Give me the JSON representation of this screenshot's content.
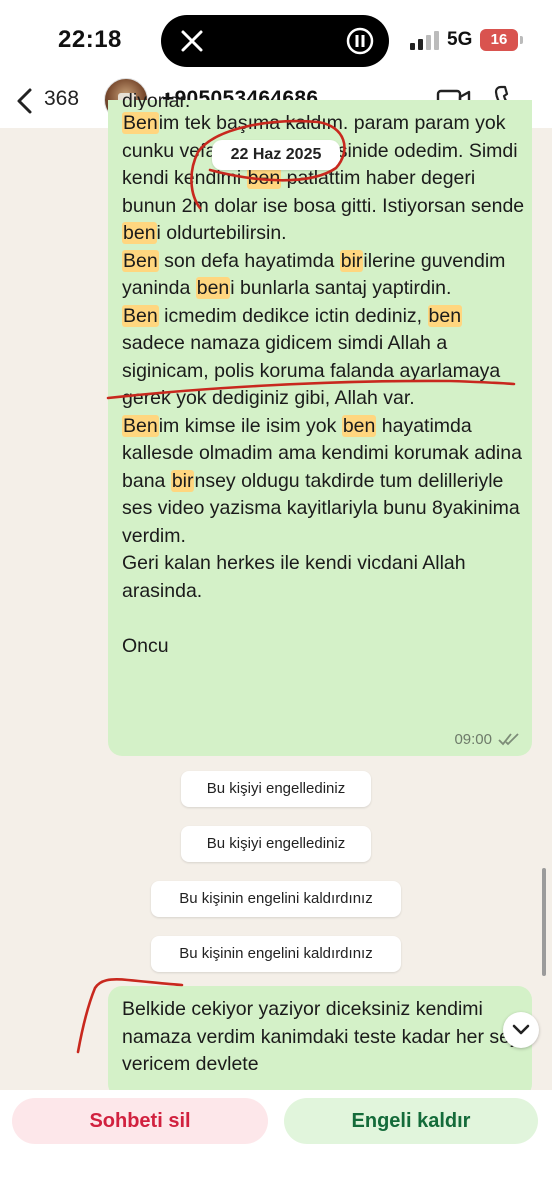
{
  "status": {
    "time": "22:18",
    "network": "5G",
    "battery": "16",
    "island_icon": "x-logo-icon"
  },
  "header": {
    "back_count": "368",
    "contact": "+905053464686"
  },
  "date_separator": "22 Haz 2025",
  "message1": {
    "partial_top": "diyorlar.",
    "time": "09:00",
    "paragraphs": [
      [
        {
          "t": "Ben",
          "h": true
        },
        {
          "t": "im tek başıma kaldım. "
        },
        {
          "t": "param param yok cunku vefat sonrasi vergisinide odedim. Simdi kendi kendimi "
        },
        {
          "t": "ben",
          "h": true
        },
        {
          "t": " patlattim haber degeri bunun 2m dolar ise bosa gitti. Istiyorsan sende "
        },
        {
          "t": "ben",
          "h": true
        },
        {
          "t": "i oldurtebilirsin."
        }
      ],
      [
        {
          "t": "Ben",
          "h": true
        },
        {
          "t": " son defa hayatimda "
        },
        {
          "t": "bir",
          "h": true
        },
        {
          "t": "ilerine guvendim yaninda "
        },
        {
          "t": "ben",
          "h": true
        },
        {
          "t": "i bunlarla santaj yaptirdin."
        }
      ],
      [
        {
          "t": "Ben",
          "h": true
        },
        {
          "t": " icmedim dedikce ictin dediniz, "
        },
        {
          "t": "ben",
          "h": true
        },
        {
          "t": " sadece namaza gidicem simdi Allah a siginicam, polis koruma falanda ayarlamaya gerek yok dediginiz gibi, Allah var."
        }
      ],
      [
        {
          "t": "Ben",
          "h": true
        },
        {
          "t": "im kimse ile isim yok "
        },
        {
          "t": "ben",
          "h": true
        },
        {
          "t": " hayatimda kallesde olmadim ama kendimi korumak adina bana "
        },
        {
          "t": "bir",
          "h": true
        },
        {
          "t": "nsey oldugu takdirde tum delilleriyle ses video yazisma kayitlariyla bunu 8yakinima verdim."
        }
      ],
      [
        {
          "t": "Geri kalan herkes ile kendi vicdani Allah arasinda."
        }
      ],
      [
        {
          "t": ""
        }
      ],
      [
        {
          "t": "Oncu"
        }
      ]
    ]
  },
  "system_notices": [
    "Bu kişiyi engellediniz",
    "Bu kişiyi engellediniz",
    "Bu kişinin engelini kaldırdınız",
    "Bu kişinin engelini kaldırdınız"
  ],
  "message2": {
    "text": "Belkide cekiyor yaziyor diceksiniz kendimi namaza verdim kanimdaki teste kadar her seyi vericem devlete"
  },
  "actions": {
    "delete_chat": "Sohbeti sil",
    "unblock": "Engeli kaldır"
  },
  "colors": {
    "bubble_out": "#d4f1c8",
    "highlight": "#ffd67f",
    "annotation": "#c8281e",
    "delete": "#d1213f",
    "unblock": "#146b3a"
  }
}
